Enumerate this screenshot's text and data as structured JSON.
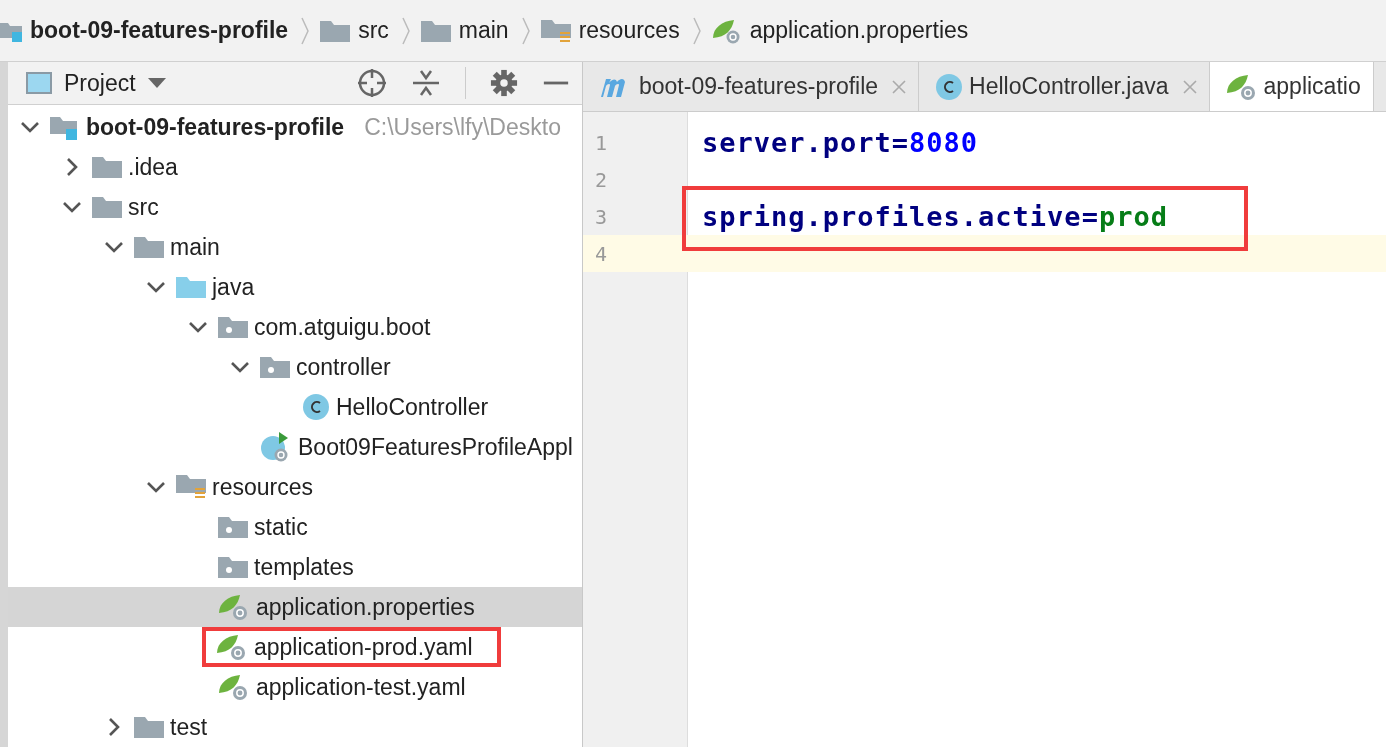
{
  "breadcrumbs": [
    {
      "label": "boot-09-features-profile",
      "kind": "module"
    },
    {
      "label": "src",
      "kind": "folder"
    },
    {
      "label": "main",
      "kind": "folder"
    },
    {
      "label": "resources",
      "kind": "resource-folder"
    },
    {
      "label": "application.properties",
      "kind": "spring-file"
    }
  ],
  "project_panel": {
    "title": "Project"
  },
  "tree": [
    {
      "label": "boot-09-features-profile",
      "kind": "module",
      "hint": "C:\\Users\\lfy\\Deskto",
      "expanded": true,
      "selected": false,
      "highlighted": false,
      "children": [
        {
          "label": ".idea",
          "kind": "folder",
          "expanded": false,
          "selected": false,
          "highlighted": false
        },
        {
          "label": "src",
          "kind": "folder",
          "expanded": true,
          "selected": false,
          "highlighted": false,
          "children": [
            {
              "label": "main",
              "kind": "folder",
              "expanded": true,
              "selected": false,
              "highlighted": false,
              "children": [
                {
                  "label": "java",
                  "kind": "source-folder",
                  "expanded": true,
                  "selected": false,
                  "highlighted": false,
                  "children": [
                    {
                      "label": "com.atguigu.boot",
                      "kind": "package",
                      "expanded": true,
                      "selected": false,
                      "highlighted": false,
                      "children": [
                        {
                          "label": "controller",
                          "kind": "package",
                          "expanded": true,
                          "selected": false,
                          "highlighted": false,
                          "children": [
                            {
                              "label": "HelloController",
                              "kind": "class",
                              "selected": false,
                              "highlighted": false
                            }
                          ]
                        },
                        {
                          "label": "Boot09FeaturesProfileAppl",
                          "kind": "app-class",
                          "selected": false,
                          "highlighted": false
                        }
                      ]
                    }
                  ]
                },
                {
                  "label": "resources",
                  "kind": "resource-folder",
                  "expanded": true,
                  "selected": false,
                  "highlighted": false,
                  "children": [
                    {
                      "label": "static",
                      "kind": "package",
                      "selected": false,
                      "highlighted": false
                    },
                    {
                      "label": "templates",
                      "kind": "package",
                      "selected": false,
                      "highlighted": false
                    },
                    {
                      "label": "application.properties",
                      "kind": "spring-file",
                      "selected": true,
                      "highlighted": false
                    },
                    {
                      "label": "application-prod.yaml",
                      "kind": "spring-file",
                      "selected": false,
                      "highlighted": true
                    },
                    {
                      "label": "application-test.yaml",
                      "kind": "spring-file",
                      "selected": false,
                      "highlighted": false
                    }
                  ]
                }
              ]
            },
            {
              "label": "test",
              "kind": "folder",
              "expanded": false,
              "selected": false,
              "highlighted": false
            }
          ]
        }
      ]
    }
  ],
  "tabs": [
    {
      "label": "boot-09-features-profile",
      "kind": "maven",
      "selected": false,
      "closable": true
    },
    {
      "label": "HelloController.java",
      "kind": "class",
      "selected": false,
      "closable": true
    },
    {
      "label": "applicatio",
      "kind": "spring-file",
      "selected": true,
      "closable": false
    }
  ],
  "editor": {
    "lines": [
      {
        "number": "1",
        "current": false,
        "highlighted": false,
        "tokens": [
          {
            "text": "server.port",
            "kind": "key"
          },
          {
            "text": "=",
            "kind": "op"
          },
          {
            "text": "8080",
            "kind": "number"
          }
        ]
      },
      {
        "number": "2",
        "current": false,
        "highlighted": false
      },
      {
        "number": "3",
        "current": false,
        "highlighted": true,
        "tokens": [
          {
            "text": "spring.profiles.active",
            "kind": "key"
          },
          {
            "text": "=",
            "kind": "op"
          },
          {
            "text": "prod",
            "kind": "value"
          }
        ]
      },
      {
        "number": "4",
        "current": true,
        "highlighted": false
      }
    ]
  }
}
